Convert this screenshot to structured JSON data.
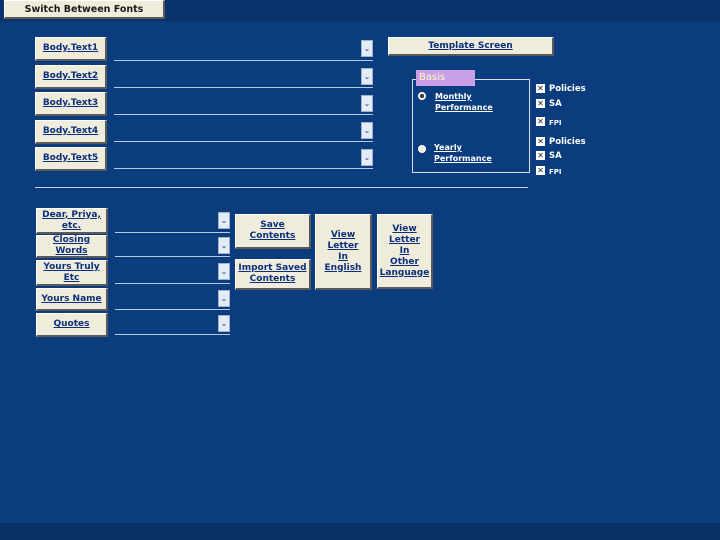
{
  "title_button": "Switch Between Fonts",
  "template_screen_button": "Template Screen",
  "body_texts": [
    {
      "label": "Body.Text1"
    },
    {
      "label": "Body.Text2"
    },
    {
      "label": "Body.Text3"
    },
    {
      "label": "Body.Text4"
    },
    {
      "label": "Body.Text5"
    }
  ],
  "basis": {
    "label": "Basis",
    "monthly": "Monthly\nPerformance",
    "yearly": "Yearly\nPerformance",
    "monthly_checks": [
      "Policies",
      "SA",
      "FPI"
    ],
    "yearly_checks": [
      "Policies",
      "SA",
      "FPI"
    ]
  },
  "letter_fields": [
    {
      "label": "Dear, Priya,\netc."
    },
    {
      "label": "Closing Words"
    },
    {
      "label": "Yours Truly\nEtc"
    },
    {
      "label": "Yours Name"
    },
    {
      "label": "Quotes"
    }
  ],
  "actions": {
    "save": "Save\nContents",
    "import": "Import Saved\nContents",
    "view_english": "View\nLetter\nIn\nEnglish",
    "view_other": "View\nLetter\nIn\nOther\nLanguage"
  },
  "colors": {
    "background": "#0b3c7e",
    "button_face": "#f0ecdc",
    "button_text": "#0b2f7a",
    "basis_label_bg": "#c9a0e8"
  }
}
